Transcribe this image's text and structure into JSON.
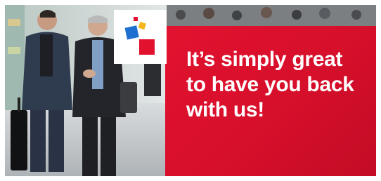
{
  "banner": {
    "headline_lines": [
      "It’s simply great",
      "to have you back",
      "with us!"
    ]
  },
  "colors": {
    "brand_red": "#e2122f",
    "logo_blue": "#1f6fd1",
    "logo_yellow": "#f3b61f",
    "logo_red": "#e2122f"
  },
  "icons": {
    "logo": "trade-fair-squares-logo"
  }
}
